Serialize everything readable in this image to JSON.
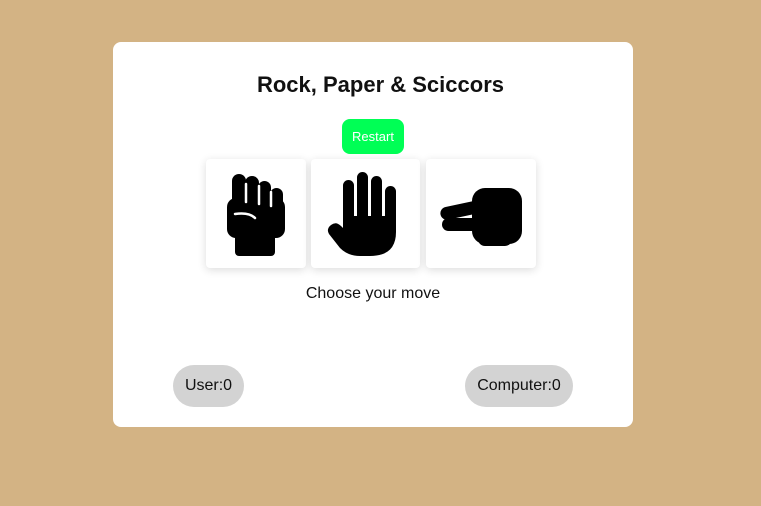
{
  "game": {
    "title": "Rock, Paper & Sciccors",
    "restart_label": "Restart",
    "prompt": "Choose your move"
  },
  "moves": [
    {
      "name": "rock",
      "icon": "fist-icon"
    },
    {
      "name": "paper",
      "icon": "open-hand-icon"
    },
    {
      "name": "scissors",
      "icon": "scissors-hand-icon"
    }
  ],
  "score": {
    "user_label": "User:0",
    "computer_label": "Computer:0"
  },
  "colors": {
    "background": "#d3b384",
    "card": "#ffffff",
    "restart_button": "#00ff55",
    "score_pill": "#d3d3d3"
  }
}
